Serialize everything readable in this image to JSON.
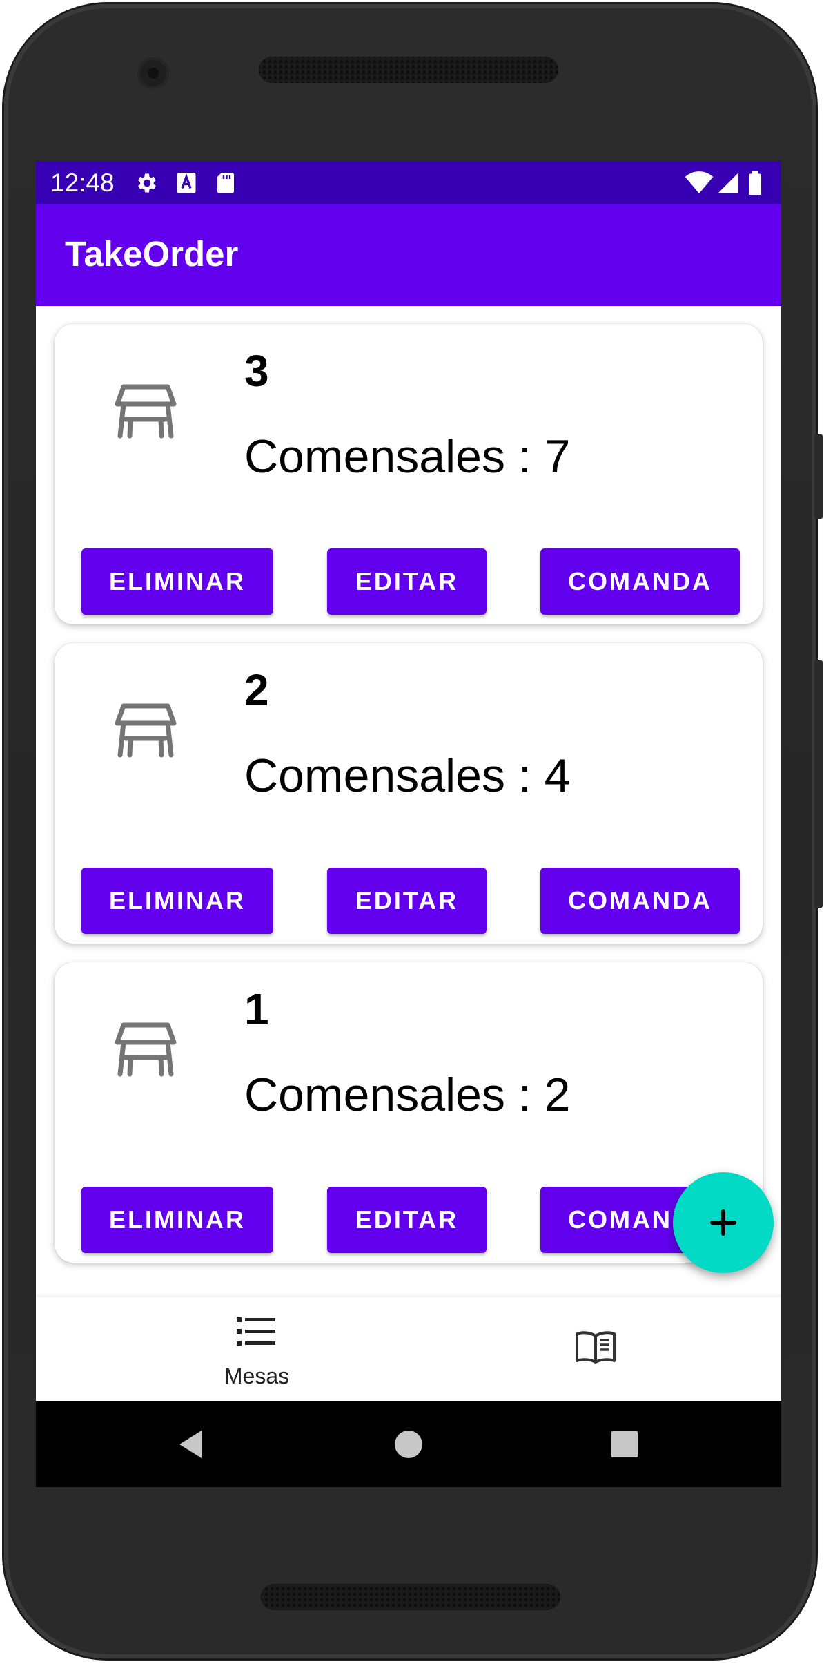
{
  "status_bar": {
    "time": "12:48",
    "left_icons": [
      "settings-icon",
      "a-notification-icon",
      "sd-card-icon"
    ],
    "right_icons": [
      "wifi-icon",
      "cell-signal-icon",
      "battery-icon"
    ],
    "background": "#3700b3"
  },
  "app_bar": {
    "title": "TakeOrder",
    "background": "#6200ee"
  },
  "tables": [
    {
      "number": "3",
      "diners_text": "Comensales : 7",
      "delete_label": "ELIMINAR",
      "edit_label": "EDITAR",
      "order_label": "COMANDA"
    },
    {
      "number": "2",
      "diners_text": "Comensales : 4",
      "delete_label": "ELIMINAR",
      "edit_label": "EDITAR",
      "order_label": "COMANDA"
    },
    {
      "number": "1",
      "diners_text": "Comensales : 2",
      "delete_label": "ELIMINAR",
      "edit_label": "EDITAR",
      "order_label": "COMANDA"
    }
  ],
  "fab": {
    "icon": "plus-icon",
    "color": "#03dac5"
  },
  "bottom_nav": {
    "items": [
      {
        "label": "Mesas",
        "icon": "list-icon",
        "selected": true
      },
      {
        "label": "",
        "icon": "menu-book-icon",
        "selected": false
      }
    ]
  },
  "system_nav": {
    "buttons": [
      "back-icon",
      "home-icon",
      "recents-icon"
    ]
  },
  "colors": {
    "primary": "#6200ee",
    "primary_dark": "#3700b3",
    "accent": "#03dac5"
  }
}
